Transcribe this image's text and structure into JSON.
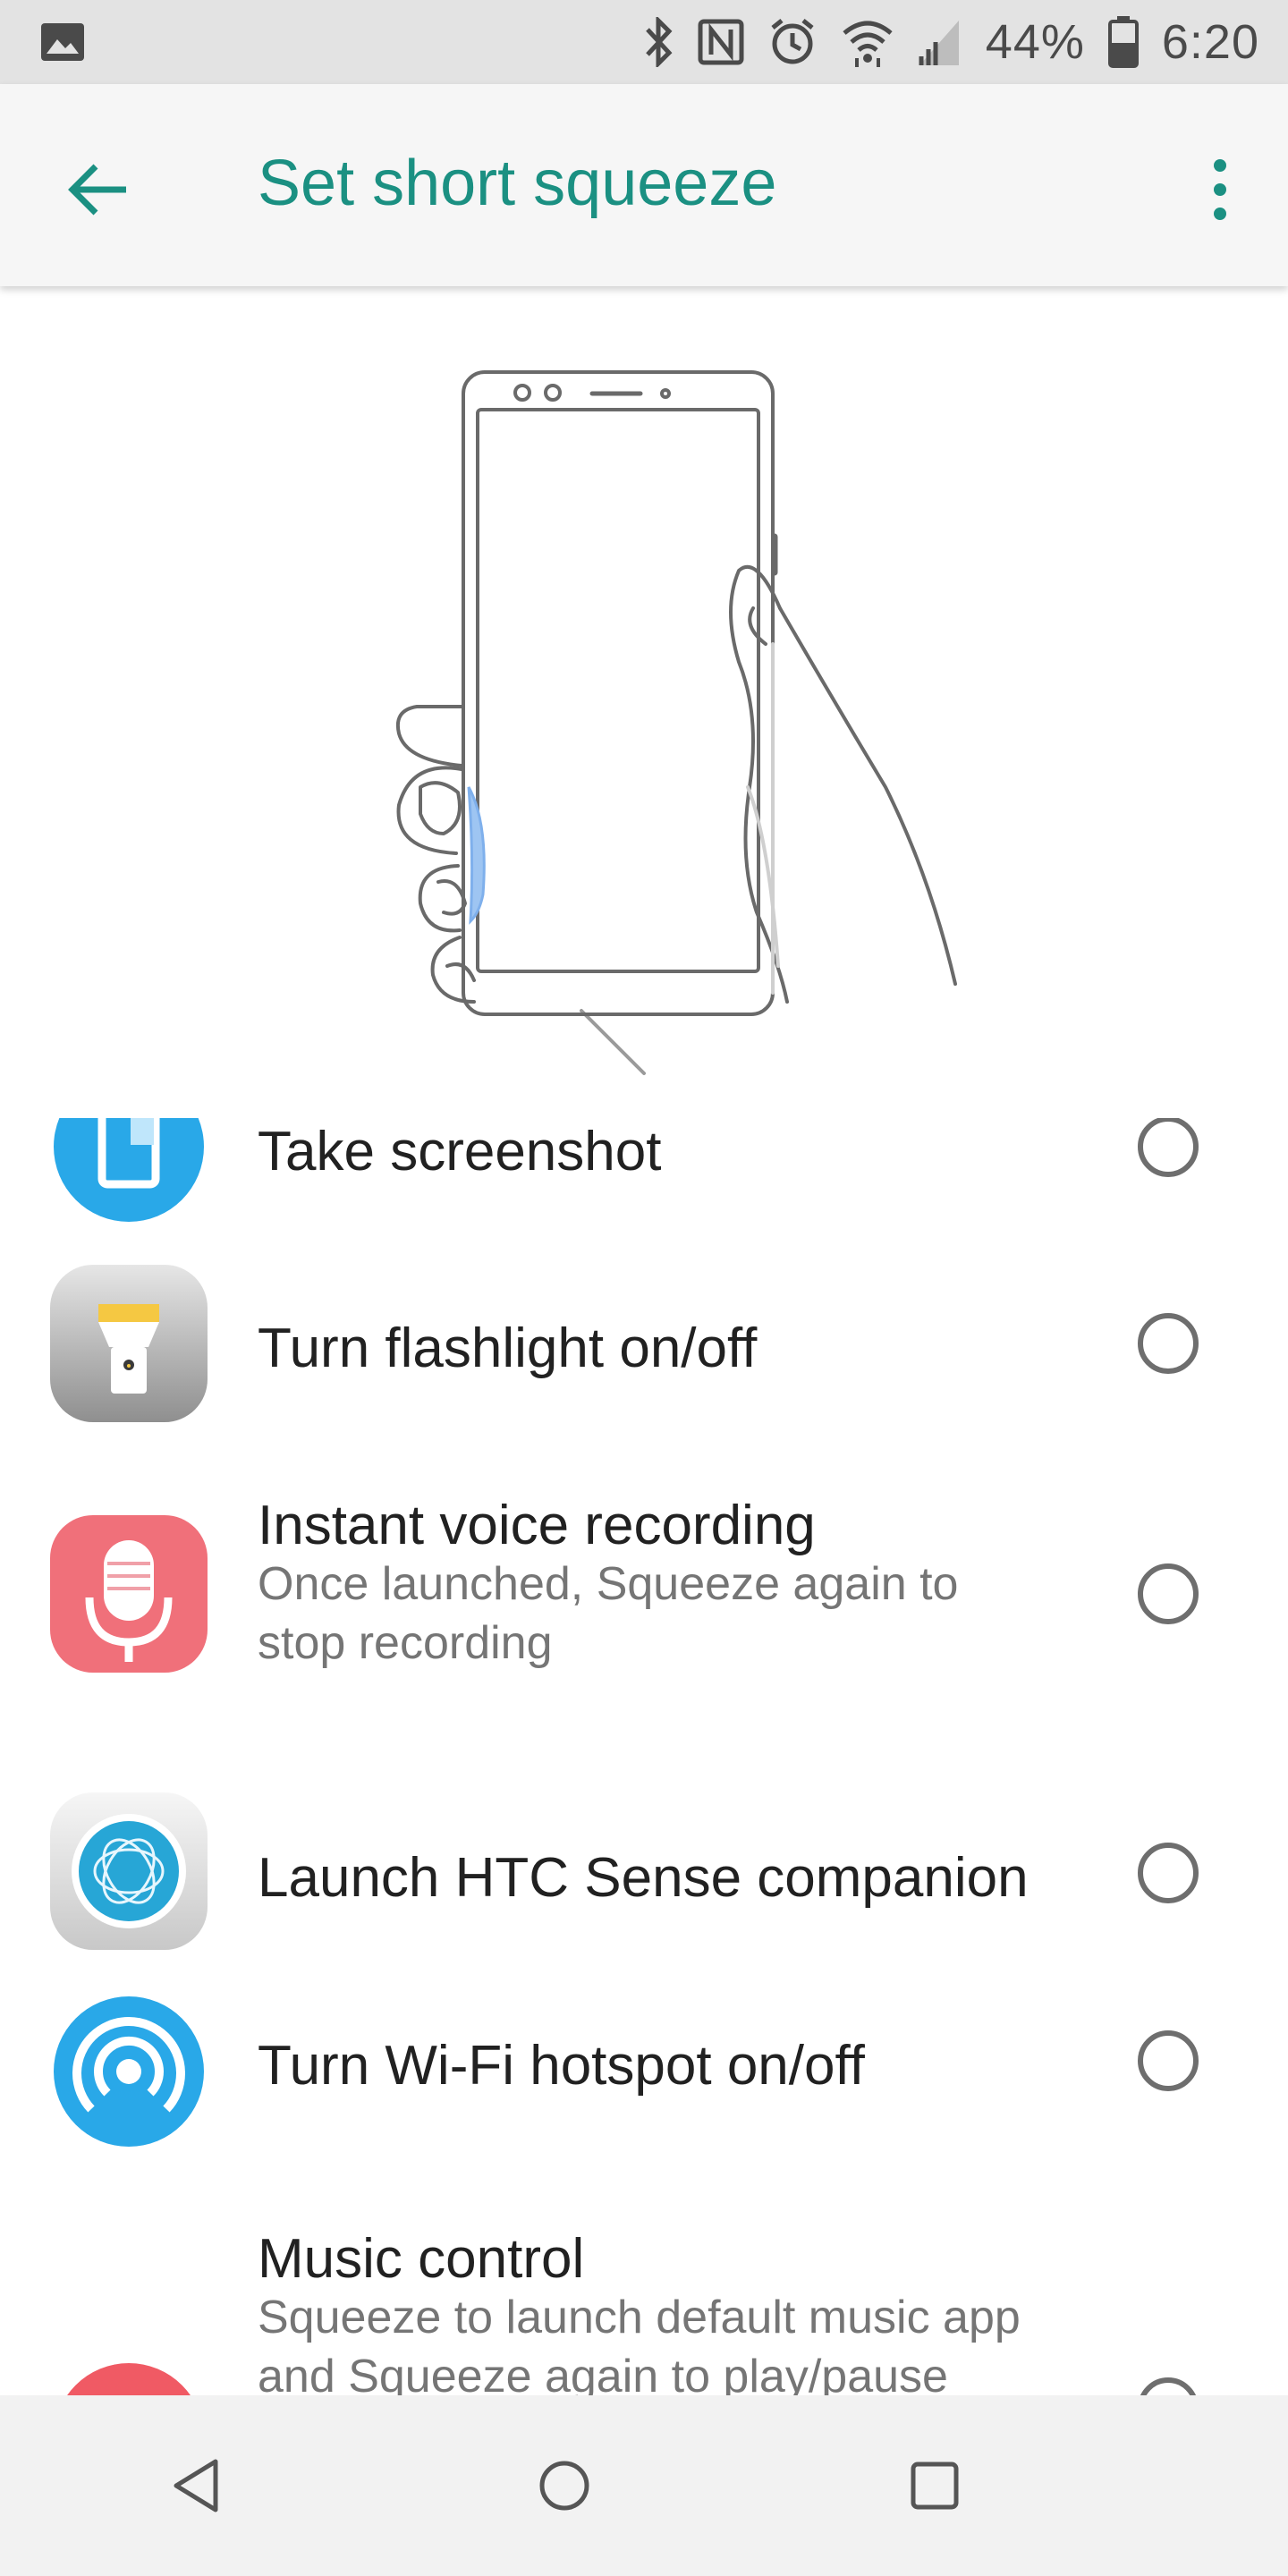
{
  "status_bar": {
    "battery_percent": "44%",
    "time": "6:20",
    "icons": [
      "gallery-icon",
      "bluetooth-icon",
      "nfc-icon",
      "alarm-icon",
      "wifi-icon",
      "signal-icon",
      "battery-icon"
    ]
  },
  "app_bar": {
    "title": "Set short squeeze",
    "back_icon": "arrow-back-icon",
    "menu_icon": "more-vert-icon"
  },
  "options": [
    {
      "label": "Take screenshot",
      "description": "",
      "icon": "screenshot-icon",
      "selected": false
    },
    {
      "label": "Turn flashlight on/off",
      "description": "",
      "icon": "flashlight-icon",
      "selected": false
    },
    {
      "label": "Instant voice recording",
      "description": "Once launched, Squeeze again to stop recording",
      "icon": "microphone-icon",
      "selected": false
    },
    {
      "label": "Launch HTC Sense companion",
      "description": "",
      "icon": "sense-companion-icon",
      "selected": false
    },
    {
      "label": "Turn Wi-Fi hotspot on/off",
      "description": "",
      "icon": "hotspot-icon",
      "selected": false
    },
    {
      "label": "Music control",
      "description": "Squeeze to launch default music app and Squeeze again to play/pause",
      "icon": "music-note-icon",
      "selected": false
    }
  ],
  "nav_bar": {
    "icons": [
      "nav-back-icon",
      "nav-home-icon",
      "nav-recents-icon"
    ]
  },
  "colors": {
    "accent": "#1b9082",
    "status_bar": "#e3e3e3",
    "app_bar": "#f6f6f6",
    "nav_bar": "#f2f2f2"
  }
}
